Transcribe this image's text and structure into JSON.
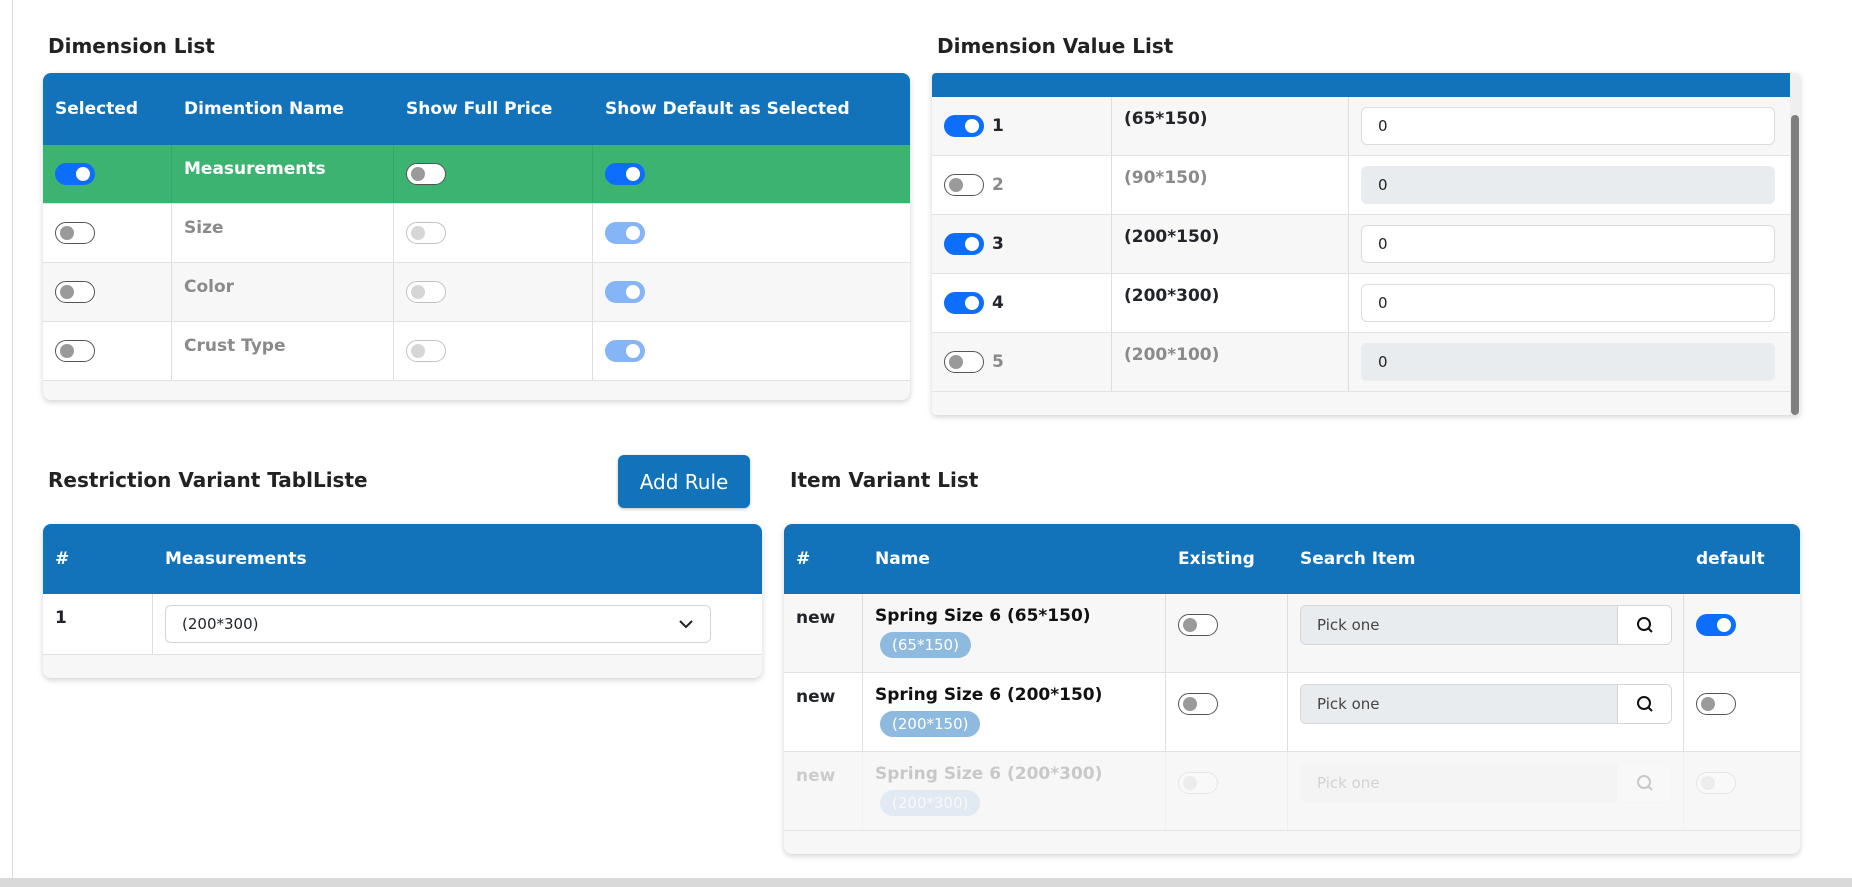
{
  "dimension_list": {
    "title": "Dimension List",
    "headers": [
      "Selected",
      "Dimention Name",
      "Show Full Price",
      "Show Default as Selected"
    ],
    "rows": [
      {
        "name": "Measurements",
        "selected": true,
        "show_full_price": false,
        "show_default_selected": true
      },
      {
        "name": "Size",
        "selected": false,
        "show_full_price": false,
        "show_default_selected": true
      },
      {
        "name": "Color",
        "selected": false,
        "show_full_price": false,
        "show_default_selected": true
      },
      {
        "name": "Crust Type",
        "selected": false,
        "show_full_price": false,
        "show_default_selected": true
      }
    ]
  },
  "dimension_value_list": {
    "title": "Dimension Value List",
    "rows": [
      {
        "num": "1",
        "name": "(65*150)",
        "value": "0",
        "enabled": true
      },
      {
        "num": "2",
        "name": "(90*150)",
        "value": "0",
        "enabled": false
      },
      {
        "num": "3",
        "name": "(200*150)",
        "value": "0",
        "enabled": true
      },
      {
        "num": "4",
        "name": "(200*300)",
        "value": "0",
        "enabled": true
      },
      {
        "num": "5",
        "name": "(200*100)",
        "value": "0",
        "enabled": false
      }
    ]
  },
  "restriction": {
    "title": "Restriction Variant TablListe",
    "add_button": "Add Rule",
    "headers": [
      "#",
      "Measurements"
    ],
    "rows": [
      {
        "num": "1",
        "selected": "(200*300)"
      }
    ]
  },
  "item_variant": {
    "title": "Item Variant List",
    "headers": [
      "#",
      "Name",
      "Existing",
      "Search Item",
      "default"
    ],
    "rows": [
      {
        "num": "new",
        "name": "Spring Size 6 (65*150)",
        "tag": "(65*150)",
        "existing": false,
        "search_placeholder": "Pick one",
        "default": true
      },
      {
        "num": "new",
        "name": "Spring Size 6 (200*150)",
        "tag": "(200*150)",
        "existing": false,
        "search_placeholder": "Pick one",
        "default": false
      },
      {
        "num": "new",
        "name": "Spring Size 6 (200*300)",
        "tag": "(200*300)",
        "existing": false,
        "search_placeholder": "Pick one",
        "default": false
      }
    ]
  },
  "icons": {
    "search": "search-icon",
    "dropdown": "chevron-down-icon"
  },
  "colors": {
    "header_blue": "#1273bb",
    "selected_green": "#3cb371",
    "toggle_blue": "#0d6efd"
  }
}
